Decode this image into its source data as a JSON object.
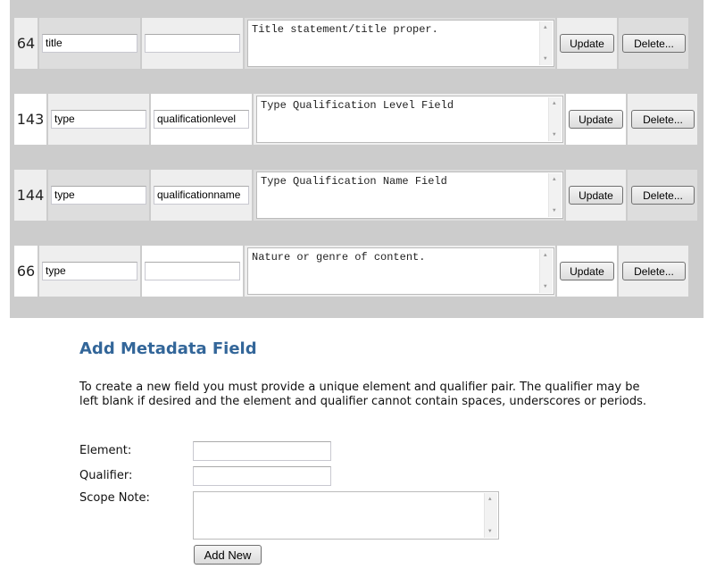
{
  "fields": [
    {
      "id": "64",
      "element": "title",
      "qualifier": "",
      "scope_note": "Title statement/title proper."
    },
    {
      "id": "143",
      "element": "type",
      "qualifier": "qualificationlevel",
      "scope_note": "Type Qualification Level Field"
    },
    {
      "id": "144",
      "element": "type",
      "qualifier": "qualificationname",
      "scope_note": "Type Qualification Name Field"
    },
    {
      "id": "66",
      "element": "type",
      "qualifier": "",
      "scope_note": "Nature or genre of content."
    }
  ],
  "buttons": {
    "update": "Update",
    "delete": "Delete..."
  },
  "add_form": {
    "heading": "Add Metadata Field",
    "description": "To create a new field you must provide a unique element and qualifier pair. The qualifier may be left blank if desired and the element and qualifier cannot contain spaces, underscores or periods.",
    "element_label": "Element:",
    "element_value": "",
    "qualifier_label": "Qualifier:",
    "qualifier_value": "",
    "scope_label": "Scope Note:",
    "scope_value": "",
    "add_button": "Add New"
  },
  "colors": {
    "heading": "#336699",
    "panel": "#cccccc"
  }
}
